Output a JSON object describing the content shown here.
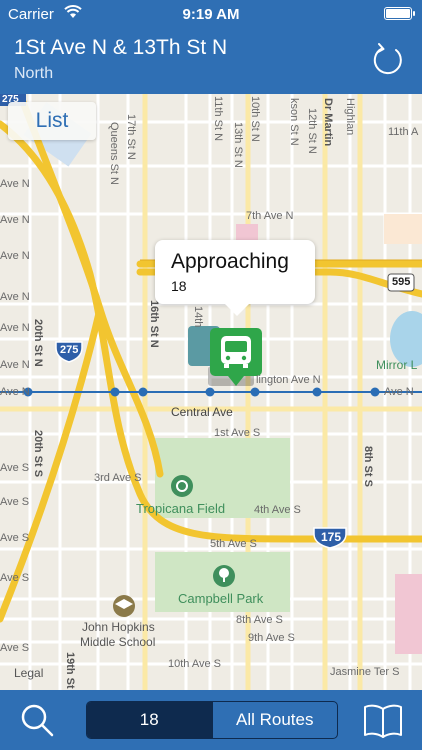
{
  "status_bar": {
    "carrier": "Carrier",
    "time": "9:19 AM",
    "battery_level": 1.0
  },
  "header": {
    "title": "1St Ave N & 13Th St N",
    "direction": "North",
    "refresh_icon": "refresh-icon"
  },
  "map": {
    "list_button": "List",
    "callout": {
      "title": "Approaching",
      "subtitle": "18"
    },
    "shields": {
      "i275": "275",
      "i175": "175",
      "s595": "595",
      "top_left": "275"
    },
    "street_labels": {
      "seventh_ave_n": "7th Ave N",
      "central_ave": "Central Ave",
      "first_ave_s": "1st Ave S",
      "third_ave_s": "3rd Ave S",
      "fourth_ave_s": "4th Ave S",
      "fifth_ave_s": "5th Ave S",
      "eighth_ave_s": "8th Ave S",
      "ninth_ave_s": "9th Ave S",
      "tenth_ave_s": "10th Ave S",
      "jasmine_ter_s": "Jasmine Ter S",
      "arlington_ave_n": "lington Ave N",
      "ave_n_left": "Ave N",
      "ave_n_right": "Ave N",
      "eleventh_ave": "11th A",
      "left_ave_n_1": "Ave N",
      "left_ave_n_2": "Ave N",
      "left_ave_n_3": "Ave N",
      "left_ave_n_4": "Ave N",
      "left_ave_n_5": "Ave N",
      "left_ave_n_6": "Ave N",
      "left_ave_s_1": "Ave S",
      "left_ave_s_2": "Ave S",
      "left_ave_s_3": "Ave S",
      "left_ave_s_4": "Ave S",
      "left_ave_s_5": "Ave S",
      "twentieth_st_n": "20th St N",
      "twentieth_st_s": "20th St S",
      "sixteenth_st_n": "16th St N",
      "fourteenth_st": "14th",
      "eighth_st_s": "8th St S",
      "nineteenth_st": "19th St",
      "seventeenth_st_n": "17th St N",
      "queens_st_n": "Queens St N",
      "dr_martin": "Dr Martin",
      "highland": "Highlan",
      "tenth_st_n": "10th St N",
      "eleventh_st_n": "11th St N",
      "thirteenth_st_n": "13th St N",
      "jackson_st_n": "kson St N",
      "twelfth_st_n": "12th St N"
    },
    "pois": {
      "tropicana": "Tropicana Field",
      "campbell_park": "Campbell Park",
      "john_hopkins_1": "John Hopkins",
      "john_hopkins_2": "Middle School",
      "mirror_lake": "Mirror L",
      "legal": "Legal"
    }
  },
  "toolbar": {
    "search_icon": "search-icon",
    "segment_route": "18",
    "segment_all": "All Routes",
    "book_icon": "book-icon"
  },
  "colors": {
    "header_blue": "#2f6fb4",
    "segment_dark": "#0e2a4e",
    "freeway_yellow": "#f2c530",
    "route_line": "#2a6db5",
    "bus_green": "#2fa64a",
    "park_green": "#cfe6c4"
  }
}
